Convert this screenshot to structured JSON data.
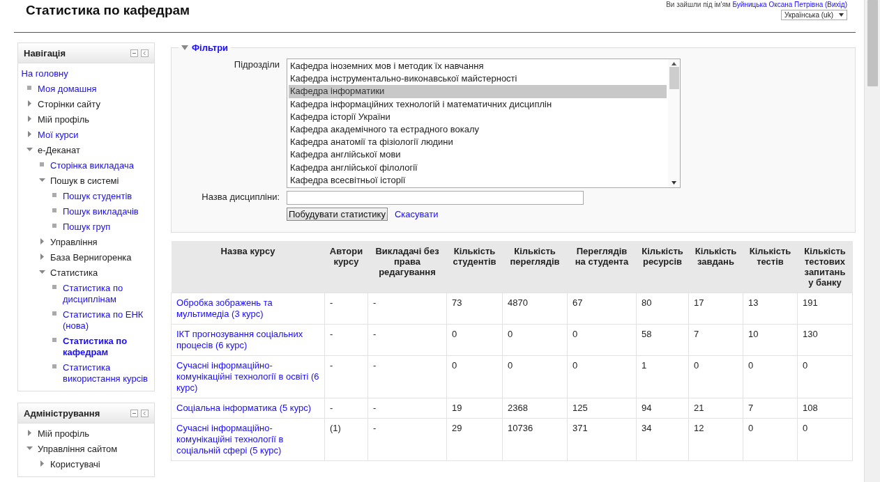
{
  "header": {
    "title": "Статистика по кафедрам",
    "login_prefix": "Ви зайшли під ім'ям",
    "user": "Буйницька Оксана Петрівна",
    "logout": "(Вихід)",
    "language": "Українська (uk)"
  },
  "blocks": [
    {
      "title": "Навігація",
      "items": [
        {
          "label": "На головну",
          "kind": "home"
        },
        {
          "label": "Моя домашня",
          "kind": "link"
        },
        {
          "label": "Сторінки сайту",
          "kind": "text",
          "expanded": false
        },
        {
          "label": "Мій профіль",
          "kind": "text",
          "expanded": false
        },
        {
          "label": "Мої курси",
          "kind": "link",
          "expanded": false
        },
        {
          "label": "е-Деканат",
          "kind": "text",
          "expanded": true,
          "children": [
            {
              "label": "Сторінка викладача",
              "kind": "link"
            },
            {
              "label": "Пошук в системі",
              "kind": "text",
              "expanded": true,
              "children": [
                {
                  "label": "Пошук студентів",
                  "kind": "link"
                },
                {
                  "label": "Пошук викладачів",
                  "kind": "link"
                },
                {
                  "label": "Пошук груп",
                  "kind": "link"
                }
              ]
            },
            {
              "label": "Управління",
              "kind": "text",
              "expanded": false
            },
            {
              "label": "База Вернигоренка",
              "kind": "text",
              "expanded": false
            },
            {
              "label": "Статистика",
              "kind": "text",
              "expanded": true,
              "children": [
                {
                  "label": "Статистика по дисциплінам",
                  "kind": "link"
                },
                {
                  "label": "Статистика по ЕНК (нова)",
                  "kind": "link"
                },
                {
                  "label": "Статистика по кафедрам",
                  "kind": "current"
                },
                {
                  "label": "Статистика використання курсів",
                  "kind": "link"
                }
              ]
            }
          ]
        }
      ]
    },
    {
      "title": "Адміністрування",
      "items": [
        {
          "label": "Мій профіль",
          "kind": "text",
          "expanded": false
        },
        {
          "label": "Управління сайтом",
          "kind": "text",
          "expanded": true,
          "children": [
            {
              "label": "Користувачі",
              "kind": "text",
              "expanded": false
            }
          ]
        }
      ]
    }
  ],
  "filters": {
    "legend": "Фільтри",
    "units_label": "Підрозділи",
    "units": [
      {
        "label": "Кафедра іноземних мов і методик їх навчання",
        "selected": false
      },
      {
        "label": "Кафедра інструментально-виконавської майстерності",
        "selected": false
      },
      {
        "label": "Кафедра інформатики",
        "selected": true
      },
      {
        "label": "Кафедра інформаційних технологій і математичних дисциплін",
        "selected": false
      },
      {
        "label": "Кафедра історії України",
        "selected": false
      },
      {
        "label": "Кафедра академічного та естрадного вокалу",
        "selected": false
      },
      {
        "label": "Кафедра анатомії та фізіології людини",
        "selected": false
      },
      {
        "label": "Кафедра англійської мови",
        "selected": false
      },
      {
        "label": "Кафедра англійської філології",
        "selected": false
      },
      {
        "label": "Кафедра всесвітньої історії",
        "selected": false
      }
    ],
    "discipline_label": "Назва дисципліни:",
    "submit": "Побудувати статистику",
    "cancel": "Скасувати"
  },
  "table": {
    "columns": [
      "Назва курсу",
      "Автори курсу",
      "Викладачі без права редагування",
      "Кількість студентів",
      "Кількість переглядів",
      "Переглядів на студента",
      "Кількість ресурсів",
      "Кількість завдань",
      "Кількість тестів",
      "Кількість тестових запитань у банку"
    ],
    "rows": [
      [
        "Обробка зображень та мультимедіа (3 курс)",
        "-",
        "-",
        "73",
        "4870",
        "67",
        "80",
        "17",
        "13",
        "191"
      ],
      [
        "ІКТ прогнозування соціальних процесів (6 курс)",
        "-",
        "-",
        "0",
        "0",
        "0",
        "58",
        "7",
        "10",
        "130"
      ],
      [
        "Сучасні інформаційно-комунікаційні технології в освіті (6 курс)",
        "-",
        "-",
        "0",
        "0",
        "0",
        "1",
        "0",
        "0",
        "0"
      ],
      [
        "Соціальна інформатика (5 курс)",
        "-",
        "-",
        "19",
        "2368",
        "125",
        "94",
        "21",
        "7",
        "108"
      ],
      [
        "Сучасні інформаційно-комунікаційні технології в соціальній сфері (5 курс)",
        "(1)",
        "-",
        "29",
        "10736",
        "371",
        "34",
        "12",
        "0",
        "0"
      ]
    ]
  }
}
